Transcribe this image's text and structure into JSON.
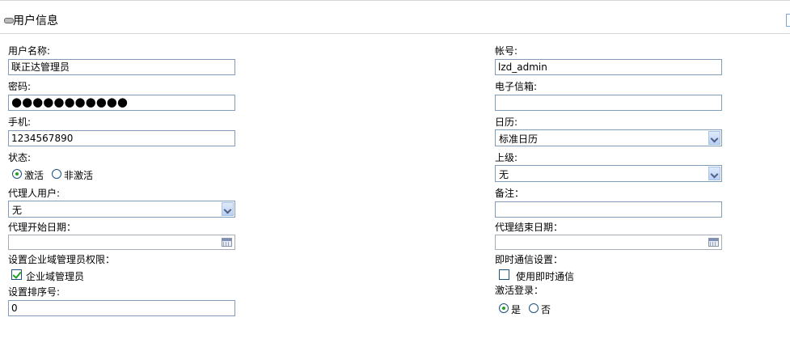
{
  "header": {
    "title": "用户信息"
  },
  "left": {
    "username_label": "用户名称:",
    "username_value": "联正达管理员",
    "password_label": "密码:",
    "password_value": "●●●●●●●●●●●",
    "mobile_label": "手机:",
    "mobile_value": "1234567890",
    "status_label": "状态:",
    "status_active": "激活",
    "status_inactive": "非激活",
    "agent_user_label": "代理人用户:",
    "agent_user_value": "无",
    "agent_start_label": "代理开始日期：",
    "enterprise_admin_perm_label": "设置企业域管理员权限：",
    "enterprise_admin_option": "企业域管理员",
    "sort_label": "设置排序号:",
    "sort_value": "0"
  },
  "right": {
    "account_label": "帐号:",
    "account_value": "lzd_admin",
    "email_label": "电子信箱:",
    "email_value": "",
    "calendar_label": "日历:",
    "calendar_value": "标准日历",
    "superior_label": "上级:",
    "superior_value": "无",
    "remark_label": "备注：",
    "remark_value": "",
    "agent_end_label": "代理结束日期：",
    "im_settings_label": "即时通信设置：",
    "im_option": "使用即时通信",
    "activate_login_label": "激活登录：",
    "activate_yes": "是",
    "activate_no": "否"
  },
  "state": {
    "status_selected": "激活",
    "enterprise_admin_checked": true,
    "im_checked": false,
    "activate_login_selected": "是"
  }
}
